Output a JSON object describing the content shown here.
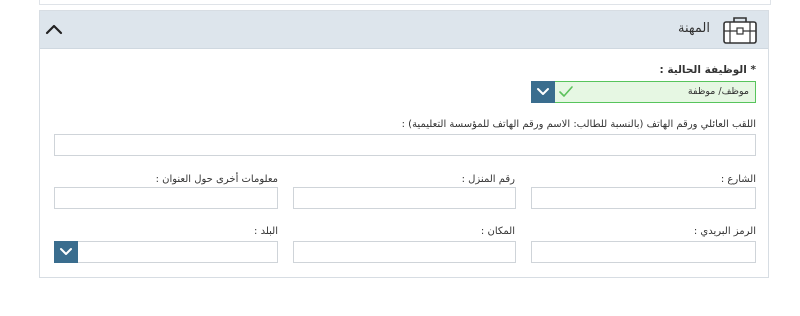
{
  "section": {
    "title": "المهنة",
    "icon": "briefcase-icon"
  },
  "form": {
    "current_job": {
      "label": "* الوظيفة الحالية :",
      "value": "موظف/ موظفة"
    },
    "family_name": {
      "label": "اللقب العائلي ورقم الهاتف (بالنسبة للطالب: الاسم ورقم الهاتف للمؤسسة التعليمية) :",
      "value": ""
    },
    "street": {
      "label": "الشارع :",
      "value": ""
    },
    "house_number": {
      "label": "رقم المنزل :",
      "value": ""
    },
    "address_info": {
      "label": "معلومات أخرى حول العنوان :",
      "value": ""
    },
    "postal_code": {
      "label": "الرمز البريدي :",
      "value": ""
    },
    "place": {
      "label": "المكان :",
      "value": ""
    },
    "country": {
      "label": "البلد :",
      "value": ""
    }
  },
  "colors": {
    "header_bg": "#dde5ec",
    "accent_dropdown": "#3a6d8e",
    "valid_border": "#57c45c",
    "valid_bg": "#e6f7e3"
  }
}
